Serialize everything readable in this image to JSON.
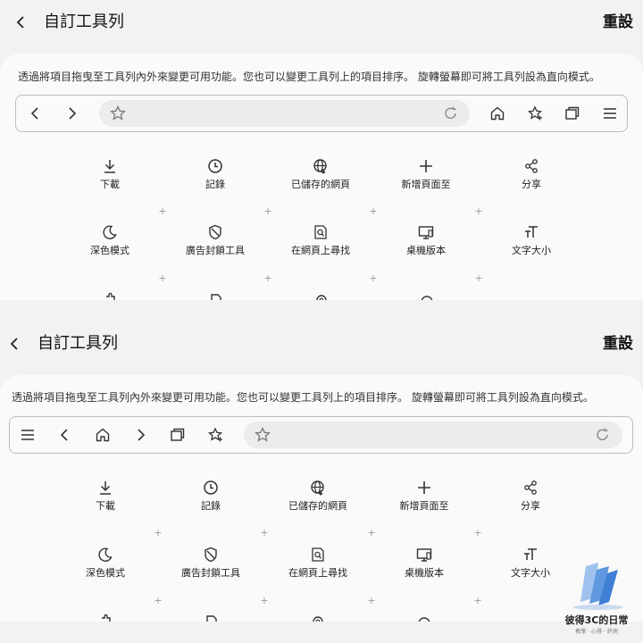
{
  "header": {
    "back_icon": "chevron-left-icon",
    "title": "自訂工具列",
    "reset_label": "重設"
  },
  "description": "透過將項目拖曳至工具列內外來變更可用功能。您也可以變更工具列上的項目排序。 旋轉螢幕即可將工具列設為直向模式。",
  "grid_items": [
    {
      "label": "下載",
      "icon": "download-icon"
    },
    {
      "label": "記錄",
      "icon": "clock-icon"
    },
    {
      "label": "已儲存的網頁",
      "icon": "saved-globe-icon"
    },
    {
      "label": "新增頁面至",
      "icon": "plus-icon"
    },
    {
      "label": "分享",
      "icon": "share-icon"
    },
    {
      "label": "深色模式",
      "icon": "moon-icon"
    },
    {
      "label": "廣告封鎖工具",
      "icon": "shield-icon"
    },
    {
      "label": "在網頁上尋找",
      "icon": "find-in-page-icon"
    },
    {
      "label": "桌機版本",
      "icon": "desktop-icon"
    },
    {
      "label": "文字大小",
      "icon": "text-size-icon"
    }
  ],
  "toolbar_landscape": [
    "back-icon",
    "forward-icon",
    "star-icon",
    "reload-icon",
    "home-icon",
    "bookmarks-icon",
    "tabs-icon",
    "menu-icon"
  ],
  "toolbar_portrait": [
    "menu-icon",
    "back-icon",
    "home-icon",
    "forward-icon",
    "tabs-icon",
    "bookmarks-icon",
    "star-icon",
    "reload-icon"
  ],
  "watermark": {
    "text": "彼得3C的日常",
    "subtext": "教學 · 心得 · 評測"
  },
  "colors": {
    "background": "#f2f2f2",
    "card": "#fafafa",
    "url_field": "#ececec",
    "border": "#bdbdbd",
    "text": "#111111",
    "watermark_blue": "#3f7fd6"
  }
}
